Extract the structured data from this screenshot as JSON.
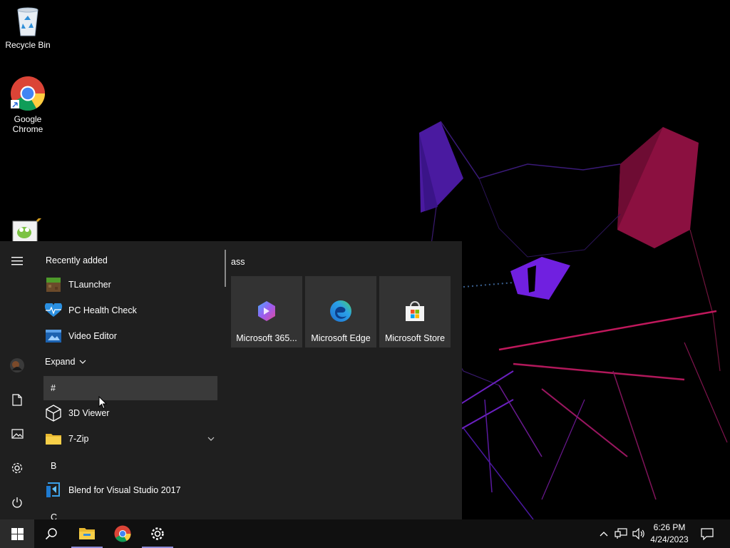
{
  "desktop": {
    "icons": [
      {
        "name": "recycle-bin-icon",
        "label": "Recycle Bin"
      },
      {
        "name": "google-chrome-icon",
        "label": "Google\nChrome"
      }
    ]
  },
  "start_menu": {
    "recently_added_label": "Recently added",
    "recent_apps": [
      {
        "label": "TLauncher",
        "icon": "tlauncher-icon"
      },
      {
        "label": "PC Health Check",
        "icon": "pc-health-check-icon"
      },
      {
        "label": "Video Editor",
        "icon": "video-editor-icon"
      }
    ],
    "expand_label": "Expand",
    "hash_header": "#",
    "apps_hash": [
      {
        "label": "3D Viewer",
        "icon": "3d-viewer-icon"
      },
      {
        "label": "7-Zip",
        "icon": "folder-icon"
      }
    ],
    "letter_b": "B",
    "apps_b": [
      {
        "label": "Blend for Visual Studio 2017",
        "icon": "blend-icon"
      }
    ],
    "letter_c": "C",
    "tiles_group_name": "ass",
    "tiles": [
      {
        "label": "Microsoft 365...",
        "icon": "microsoft-365-icon"
      },
      {
        "label": "Microsoft Edge",
        "icon": "microsoft-edge-icon"
      },
      {
        "label": "Microsoft Store",
        "icon": "microsoft-store-icon"
      }
    ],
    "rail": [
      "hamburger-menu-icon",
      "user-avatar-icon",
      "documents-icon",
      "pictures-icon",
      "settings-icon",
      "power-icon"
    ]
  },
  "taskbar": {
    "pinned": [
      "start-icon",
      "search-icon",
      "file-explorer-icon",
      "chrome-icon",
      "settings-icon"
    ],
    "clock_time": "6:26 PM",
    "clock_date": "4/24/2023",
    "tray": [
      "show-hidden-icons-chevron-icon",
      "network-icon",
      "volume-icon",
      "action-center-icon"
    ]
  },
  "colors": {
    "start_bg": "#1f1f1f",
    "tile_bg": "#333333",
    "taskbar_bg": "#101010",
    "accent": "#8e8cd8"
  }
}
